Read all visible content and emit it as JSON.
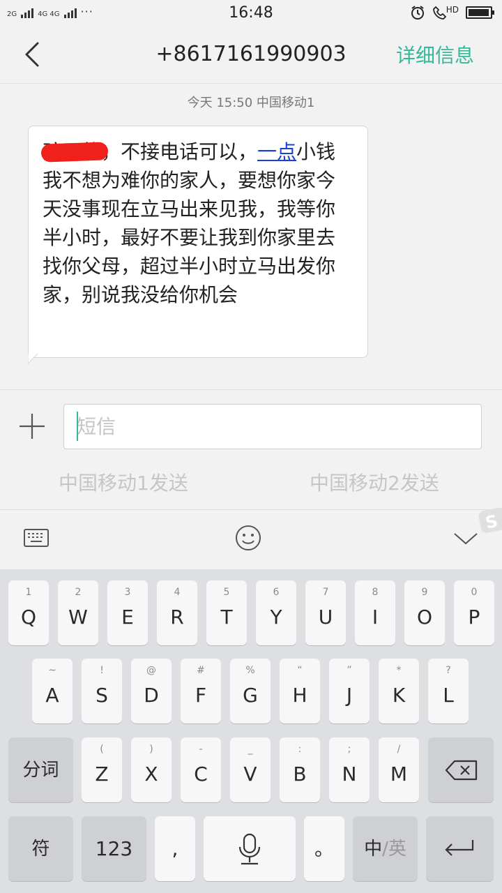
{
  "status_bar": {
    "time": "16:48",
    "sim1_network": "2G",
    "sim2_network": "4G 4G",
    "more": "···",
    "hd_badge": "HD",
    "battery_level": 0.95
  },
  "header": {
    "back_icon": "chevron-left-icon",
    "title": "+8617161990903",
    "details_label": "详细信息"
  },
  "conversation": {
    "timestamp": "今天  15:50  中国移动1",
    "message": {
      "before_link": "孩子的，不接电话可以，",
      "link_text": "一点",
      "after_link": "小钱我不想为难你的家人，要想你家今天没事现在立马出来见我，我等你半小时，最好不要让我到你家里去找你父母，超过半小时立马出发你家，别说我没给你机会"
    }
  },
  "composer": {
    "attach_icon": "plus-icon",
    "placeholder": "短信",
    "value": "",
    "send_sim1": "中国移动1发送",
    "send_sim2": "中国移动2发送"
  },
  "keyboard_toolbar": {
    "keyboard_icon": "keyboard-icon",
    "emoji_icon": "smiley-icon",
    "collapse_icon": "chevron-down-icon",
    "logo_icon": "sogou-logo-icon"
  },
  "keyboard": {
    "row1": [
      {
        "sub": "1",
        "main": "Q"
      },
      {
        "sub": "2",
        "main": "W"
      },
      {
        "sub": "3",
        "main": "E"
      },
      {
        "sub": "4",
        "main": "R"
      },
      {
        "sub": "5",
        "main": "T"
      },
      {
        "sub": "6",
        "main": "Y"
      },
      {
        "sub": "7",
        "main": "U"
      },
      {
        "sub": "8",
        "main": "I"
      },
      {
        "sub": "9",
        "main": "O"
      },
      {
        "sub": "0",
        "main": "P"
      }
    ],
    "row2": [
      {
        "sub": "~",
        "main": "A"
      },
      {
        "sub": "!",
        "main": "S"
      },
      {
        "sub": "@",
        "main": "D"
      },
      {
        "sub": "#",
        "main": "F"
      },
      {
        "sub": "%",
        "main": "G"
      },
      {
        "sub": "“",
        "main": "H"
      },
      {
        "sub": "”",
        "main": "J"
      },
      {
        "sub": "*",
        "main": "K"
      },
      {
        "sub": "?",
        "main": "L"
      }
    ],
    "row3": [
      {
        "sub": "(",
        "main": "Z"
      },
      {
        "sub": ")",
        "main": "X"
      },
      {
        "sub": "-",
        "main": "C"
      },
      {
        "sub": "_",
        "main": "V"
      },
      {
        "sub": ":",
        "main": "B"
      },
      {
        "sub": ";",
        "main": "N"
      },
      {
        "sub": "/",
        "main": "M"
      }
    ],
    "fenci_label": "分词",
    "backspace_icon": "backspace-icon",
    "symbols_label": "符",
    "numbers_label": "123",
    "comma_label": ",",
    "mic_icon": "microphone-icon",
    "period_label": "。",
    "lang_zh": "中",
    "lang_sep": "/",
    "lang_en": "英",
    "enter_icon": "enter-icon"
  },
  "colors": {
    "accent": "#35b89a",
    "link": "#1a3fd8",
    "redaction": "#f0201a"
  }
}
